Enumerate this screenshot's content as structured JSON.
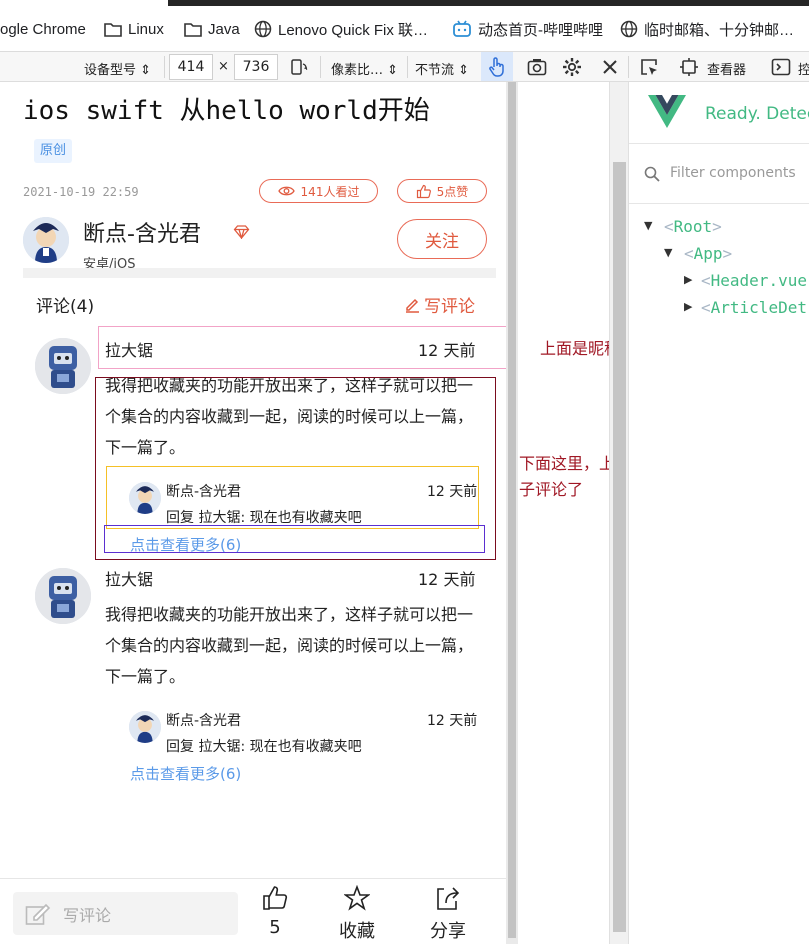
{
  "bookmarks": [
    {
      "label": "ogle Chrome",
      "icon": "chrome-icon"
    },
    {
      "label": "Linux",
      "icon": "folder-icon"
    },
    {
      "label": "Java",
      "icon": "folder-icon"
    },
    {
      "label": "Lenovo Quick Fix 联…",
      "icon": "globe-icon"
    },
    {
      "label": "动态首页-哔哩哔哩",
      "icon": "bilibili-icon"
    },
    {
      "label": "临时邮箱、十分钟邮…",
      "icon": "globe-icon"
    }
  ],
  "device_toolbar": {
    "device_model": "设备型号 ⇕",
    "width": "414",
    "times": "×",
    "height": "736",
    "pixel_ratio": "像素比… ⇕",
    "throttle": "不节流 ⇕",
    "inspector_label": "查看器",
    "truncated_label": "控"
  },
  "article": {
    "title": "ios swift 从hello world开始",
    "badge": "原创",
    "date": "2021-10-19 22:59",
    "views": "141人看过",
    "likes": "5点赞",
    "author_name": "断点-含光君",
    "author_subtitle": "安卓/iOS",
    "follow_label": "关注"
  },
  "comments_section": {
    "title": "评论(4)",
    "write_label": "写评论",
    "comments": [
      {
        "name": "拉大锯",
        "time": "12 天前",
        "body": "我得把收藏夹的功能开放出来了，这样子就可以把一个集合的内容收藏到一起，阅读的时候可以上一篇，下一篇了。",
        "reply": {
          "name": "断点-含光君",
          "time": "12 天前",
          "body": "回复 拉大锯: 现在也有收藏夹吧"
        },
        "more": "点击查看更多(6)"
      },
      {
        "name": "拉大锯",
        "time": "12 天前",
        "body": "我得把收藏夹的功能开放出来了，这样子就可以把一个集合的内容收藏到一起，阅读的时候可以上一篇，下一篇了。",
        "reply": {
          "name": "断点-含光君",
          "time": "12 天前",
          "body": "回复 拉大锯: 现在也有收藏夹吧"
        },
        "more": "点击查看更多(6)"
      }
    ]
  },
  "annotations": {
    "top_note": "上面是昵称以及发帖时间",
    "bottom_note": "下面这里，上部分是评论内容，下面就是子评论了",
    "colors": {
      "pink": "#f2a3c7",
      "maroon": "#7a0c1e",
      "yellow": "#f5c026",
      "purple": "#5b2fd0",
      "text": "#a01825"
    }
  },
  "bottom_bar": {
    "input_placeholder": "写评论",
    "like_count": "5",
    "favorite_label": "收藏",
    "share_label": "分享"
  },
  "vue_devtools": {
    "status": "Ready. Detect",
    "filter_placeholder": "Filter components",
    "tree": [
      {
        "name": "Root",
        "caret": "▼"
      },
      {
        "name": "App",
        "caret": "▼"
      },
      {
        "name": "Header.vue",
        "caret": "▶"
      },
      {
        "name": "ArticleDet",
        "caret": "▶"
      }
    ],
    "brand_color": "#42b983"
  }
}
